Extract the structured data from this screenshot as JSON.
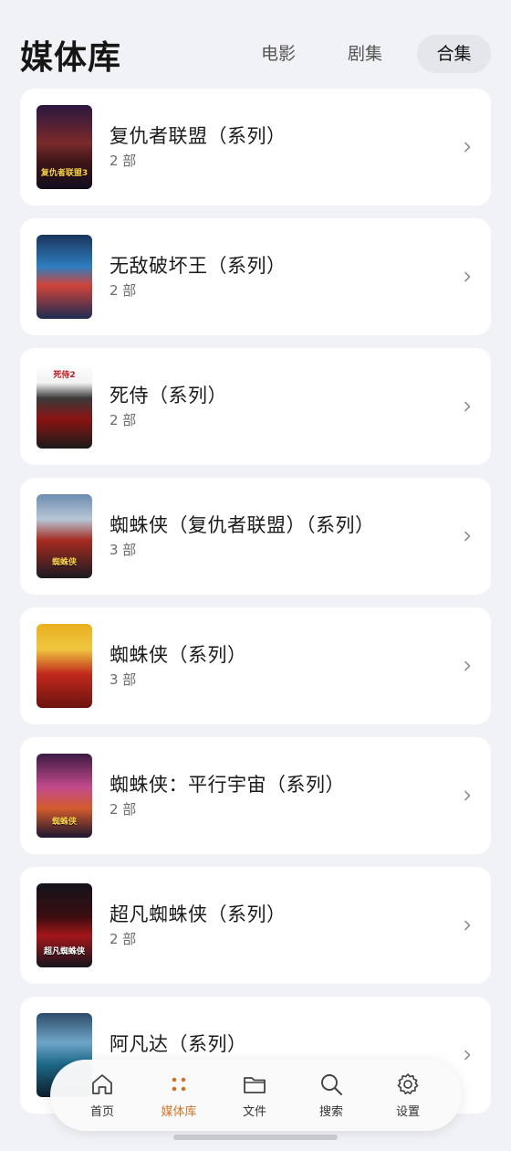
{
  "header": {
    "title": "媒体库",
    "tabs": [
      {
        "label": "电影",
        "selected": false
      },
      {
        "label": "剧集",
        "selected": false
      },
      {
        "label": "合集",
        "selected": true
      }
    ]
  },
  "collections": [
    {
      "name": "复仇者联盟（系列）",
      "count": "2 部",
      "poster_text": "复仇者联盟3"
    },
    {
      "name": "无敌破坏王（系列）",
      "count": "2 部",
      "poster_text": ""
    },
    {
      "name": "死侍（系列）",
      "count": "2 部",
      "poster_text": "死侍2"
    },
    {
      "name": "蜘蛛侠（复仇者联盟）（系列）",
      "count": "3 部",
      "poster_text": "蜘蛛侠"
    },
    {
      "name": "蜘蛛侠（系列）",
      "count": "3 部",
      "poster_text": ""
    },
    {
      "name": "蜘蛛侠：平行宇宙（系列）",
      "count": "2 部",
      "poster_text": "蜘蛛侠"
    },
    {
      "name": "超凡蜘蛛侠（系列）",
      "count": "2 部",
      "poster_text": "超凡蜘蛛侠"
    },
    {
      "name": "阿凡达（系列）",
      "count": "",
      "poster_text": ""
    }
  ],
  "nav": {
    "items": [
      {
        "label": "首页",
        "icon": "home-icon",
        "active": false
      },
      {
        "label": "媒体库",
        "icon": "library-icon",
        "active": true
      },
      {
        "label": "文件",
        "icon": "folder-icon",
        "active": false
      },
      {
        "label": "搜索",
        "icon": "search-icon",
        "active": false
      },
      {
        "label": "设置",
        "icon": "gear-icon",
        "active": false
      }
    ]
  },
  "colors": {
    "accent": "#d0742a",
    "background": "#f1f2f5",
    "card": "#ffffff",
    "selected_tab": "#e4e6ea"
  }
}
